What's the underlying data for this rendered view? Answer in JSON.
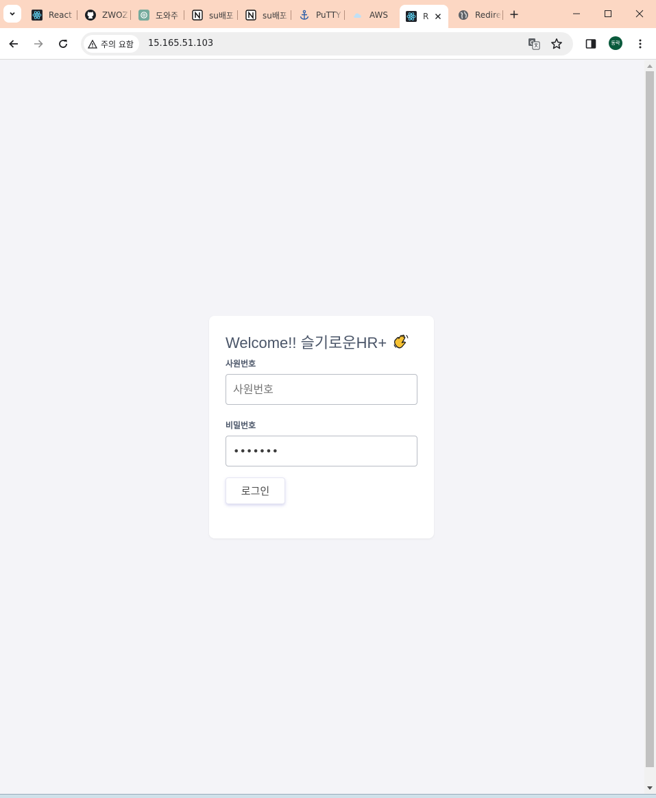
{
  "browser": {
    "tabs": [
      {
        "label": "React",
        "icon": "react-icon"
      },
      {
        "label": "ZWOZ",
        "icon": "github-icon"
      },
      {
        "label": "도와주",
        "icon": "chatgpt-icon"
      },
      {
        "label": "su배포",
        "icon": "notion-icon"
      },
      {
        "label": "su배포",
        "icon": "notion-icon"
      },
      {
        "label": "PuTTY",
        "icon": "anchor-icon"
      },
      {
        "label": "AWS",
        "icon": "cloud-icon"
      },
      {
        "label": "R",
        "icon": "react-icon",
        "active": true
      },
      {
        "label": "Redire",
        "icon": "globe-icon"
      }
    ],
    "security_chip": "주의 요함",
    "url": "15.165.51.103",
    "profile_initials": "동락",
    "colors": {
      "tabstrip": "#fcd7c3",
      "avatar": "#0a5a3c"
    }
  },
  "login": {
    "title": "Welcome!! 슬기로운HR+",
    "employee_id_label": "사원번호",
    "employee_id_placeholder": "사원번호",
    "employee_id_value": "",
    "password_label": "비밀번호",
    "password_value": "1234567",
    "submit_label": "로그인"
  }
}
